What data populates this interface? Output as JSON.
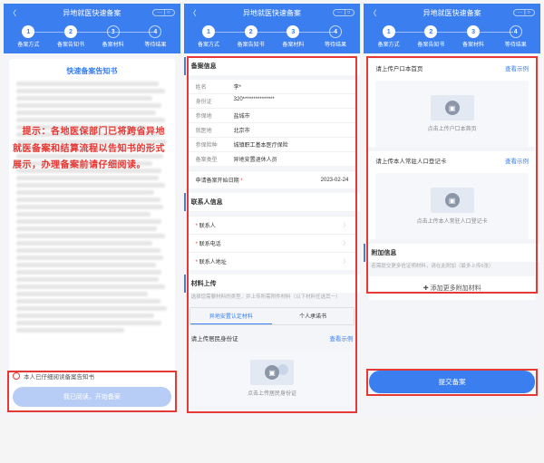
{
  "header": {
    "title": "异地就医快速备案",
    "pill": "··· | ○"
  },
  "steps": [
    {
      "num": "1",
      "label": "备案方式"
    },
    {
      "num": "2",
      "label": "备案告知书"
    },
    {
      "num": "3",
      "label": "备案材料"
    },
    {
      "num": "4",
      "label": "等待结果"
    }
  ],
  "s1": {
    "notice_title": "快速备案告知书",
    "overlay": "　提示：各地医保部门已将跨省异地就医备案和结算流程以告知书的形式展示，办理备案前请仔细阅读。",
    "check_label": "本人已仔细阅读备案告知书",
    "button": "我已阅读，开始备案"
  },
  "s2": {
    "sec_info": "备案信息",
    "info": [
      {
        "k": "姓名",
        "v": "李*"
      },
      {
        "k": "身份证",
        "v": "320***************"
      },
      {
        "k": "参保地",
        "v": "盐城市"
      },
      {
        "k": "就医地",
        "v": "北京市"
      },
      {
        "k": "参保险种",
        "v": "城镇职工基本医疗保险"
      },
      {
        "k": "备案类型",
        "v": "异地安置退休人员"
      }
    ],
    "apply_row": {
      "k": "申请备案开始日期",
      "v": "2023-02-24"
    },
    "sec_contact": "联系人信息",
    "contacts": [
      "联系人",
      "联系电话",
      "联系人地址"
    ],
    "sec_upload": "材料上传",
    "upload_hint": "选择您需要材料的类型，并上传所需附件材料（以下材料任选其一）",
    "tabs": [
      "异地安置认定材料",
      "个人承诺书"
    ],
    "id_title": "请上传居民身份证",
    "id_link": "查看示例",
    "id_cap": "点击上传居民身份证"
  },
  "s3": {
    "hk_title": "请上传户口本首页",
    "hk_cap": "点击上传户口本首页",
    "cz_title": "请上传本人常驻人口登记卡",
    "cz_cap": "点击上传本人常驻人口登记卡",
    "link": "查看示例",
    "sec_extra": "附加信息",
    "extra_hint": "若需提交更多佐证明材料，请在此附加（最多上传5张）",
    "add_label": "添加更多附加材料",
    "submit": "提交备案"
  }
}
